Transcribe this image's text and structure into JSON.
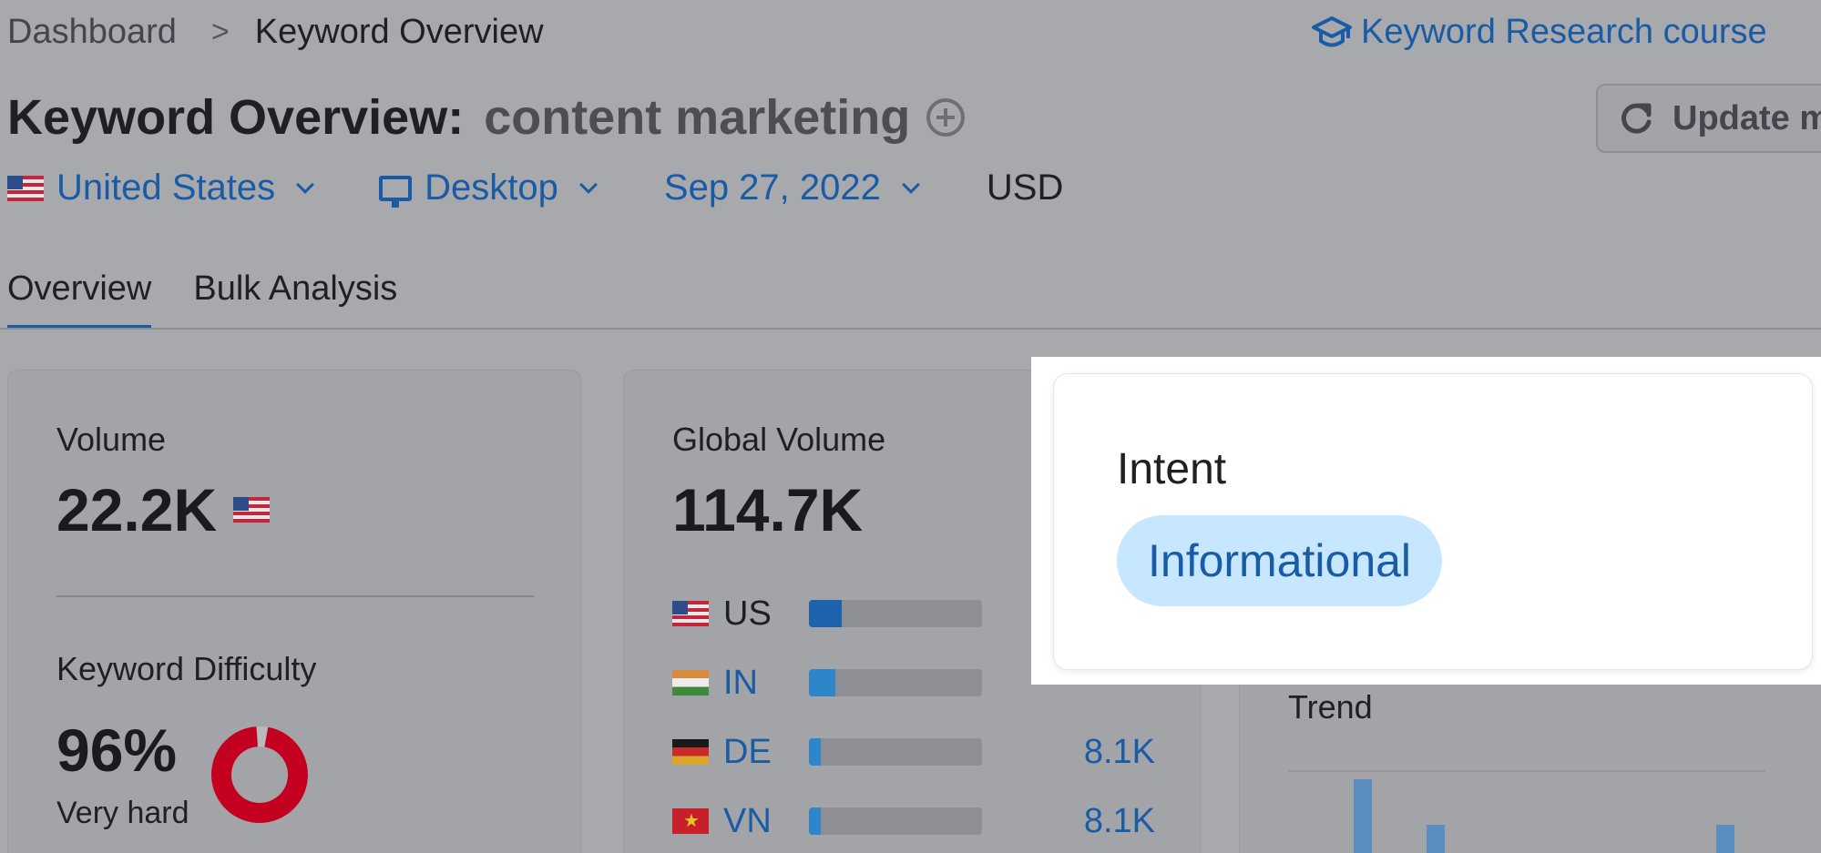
{
  "breadcrumb": {
    "root": "Dashboard",
    "separator": ">",
    "current": "Keyword Overview"
  },
  "course_link": {
    "label": "Keyword Research course",
    "icon": "graduation-cap-icon"
  },
  "title": {
    "prefix": "Keyword Overview:",
    "keyword": "content marketing"
  },
  "update_button": {
    "label": "Update m"
  },
  "filters": {
    "country": "United States",
    "device": "Desktop",
    "date": "Sep 27, 2022",
    "currency": "USD"
  },
  "tabs": [
    {
      "label": "Overview",
      "active": true
    },
    {
      "label": "Bulk Analysis",
      "active": false
    }
  ],
  "volume": {
    "label": "Volume",
    "value": "22.2K"
  },
  "keyword_difficulty": {
    "label": "Keyword Difficulty",
    "value": "96%",
    "rating": "Very hard",
    "percent": 96,
    "color": "#c3001f"
  },
  "global_volume": {
    "label": "Global Volume",
    "value": "114.7K",
    "countries": [
      {
        "code": "US",
        "share": 0.19,
        "value": ""
      },
      {
        "code": "IN",
        "share": 0.15,
        "value": ""
      },
      {
        "code": "DE",
        "share": 0.07,
        "value": "8.1K"
      },
      {
        "code": "VN",
        "share": 0.07,
        "value": "8.1K"
      }
    ]
  },
  "trend": {
    "label": "Trend",
    "bars": [
      0.9,
      0.35,
      0.35
    ]
  },
  "intent": {
    "label": "Intent",
    "value": "Informational"
  },
  "colors": {
    "accent": "#1a5ba6",
    "pill_bg": "#c7e6ff",
    "kd_red": "#c3001f"
  }
}
